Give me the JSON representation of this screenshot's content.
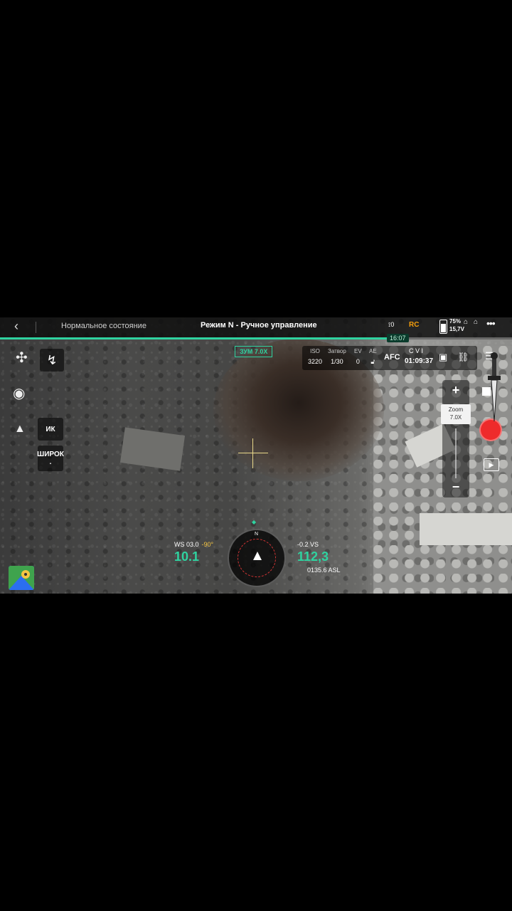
{
  "topbar": {
    "status_left": "Нормальное состояние",
    "mode": "Режим N - Ручное управление",
    "gps_count": "0",
    "rc_label": "RC",
    "battery_pct": "75%",
    "battery_volt": "15,7V",
    "time_badge": "16:07"
  },
  "flight_progress": 0.76,
  "camera": {
    "zoom_label": "ЗУМ 7.0X",
    "iso_label": "ISO",
    "iso_value": "3220",
    "shutter_label": "Затвор",
    "shutter_value": "1/30",
    "ev_label": "EV",
    "ev_value": "0",
    "ae_label": "AE",
    "afc": "AFC",
    "lock_label": "C V I",
    "rec_time": "01:09:37"
  },
  "left_panel": {
    "ir_label": "ИК",
    "wide_label": "ШИРОК",
    "wide_sub": "."
  },
  "zoom_control": {
    "plus": "+",
    "title": "Zoom",
    "value": "7.0X",
    "minus": "−",
    "level": 0.35
  },
  "telemetry": {
    "ws": "WS 03.0",
    "tilt": "-90°",
    "hs": "10.1",
    "vs": "-0.2 VS",
    "alt": "112,3",
    "asl": "0135.6 ASL"
  },
  "compass": {
    "north": "N"
  },
  "icons": {
    "back": "chevron-left-icon",
    "route": "route-icon",
    "map": "map-pin-icon"
  },
  "colors": {
    "accent": "#2fd3a0",
    "record": "#ee2b2b",
    "rc": "#f59e0b",
    "tilt": "#f5c542"
  }
}
